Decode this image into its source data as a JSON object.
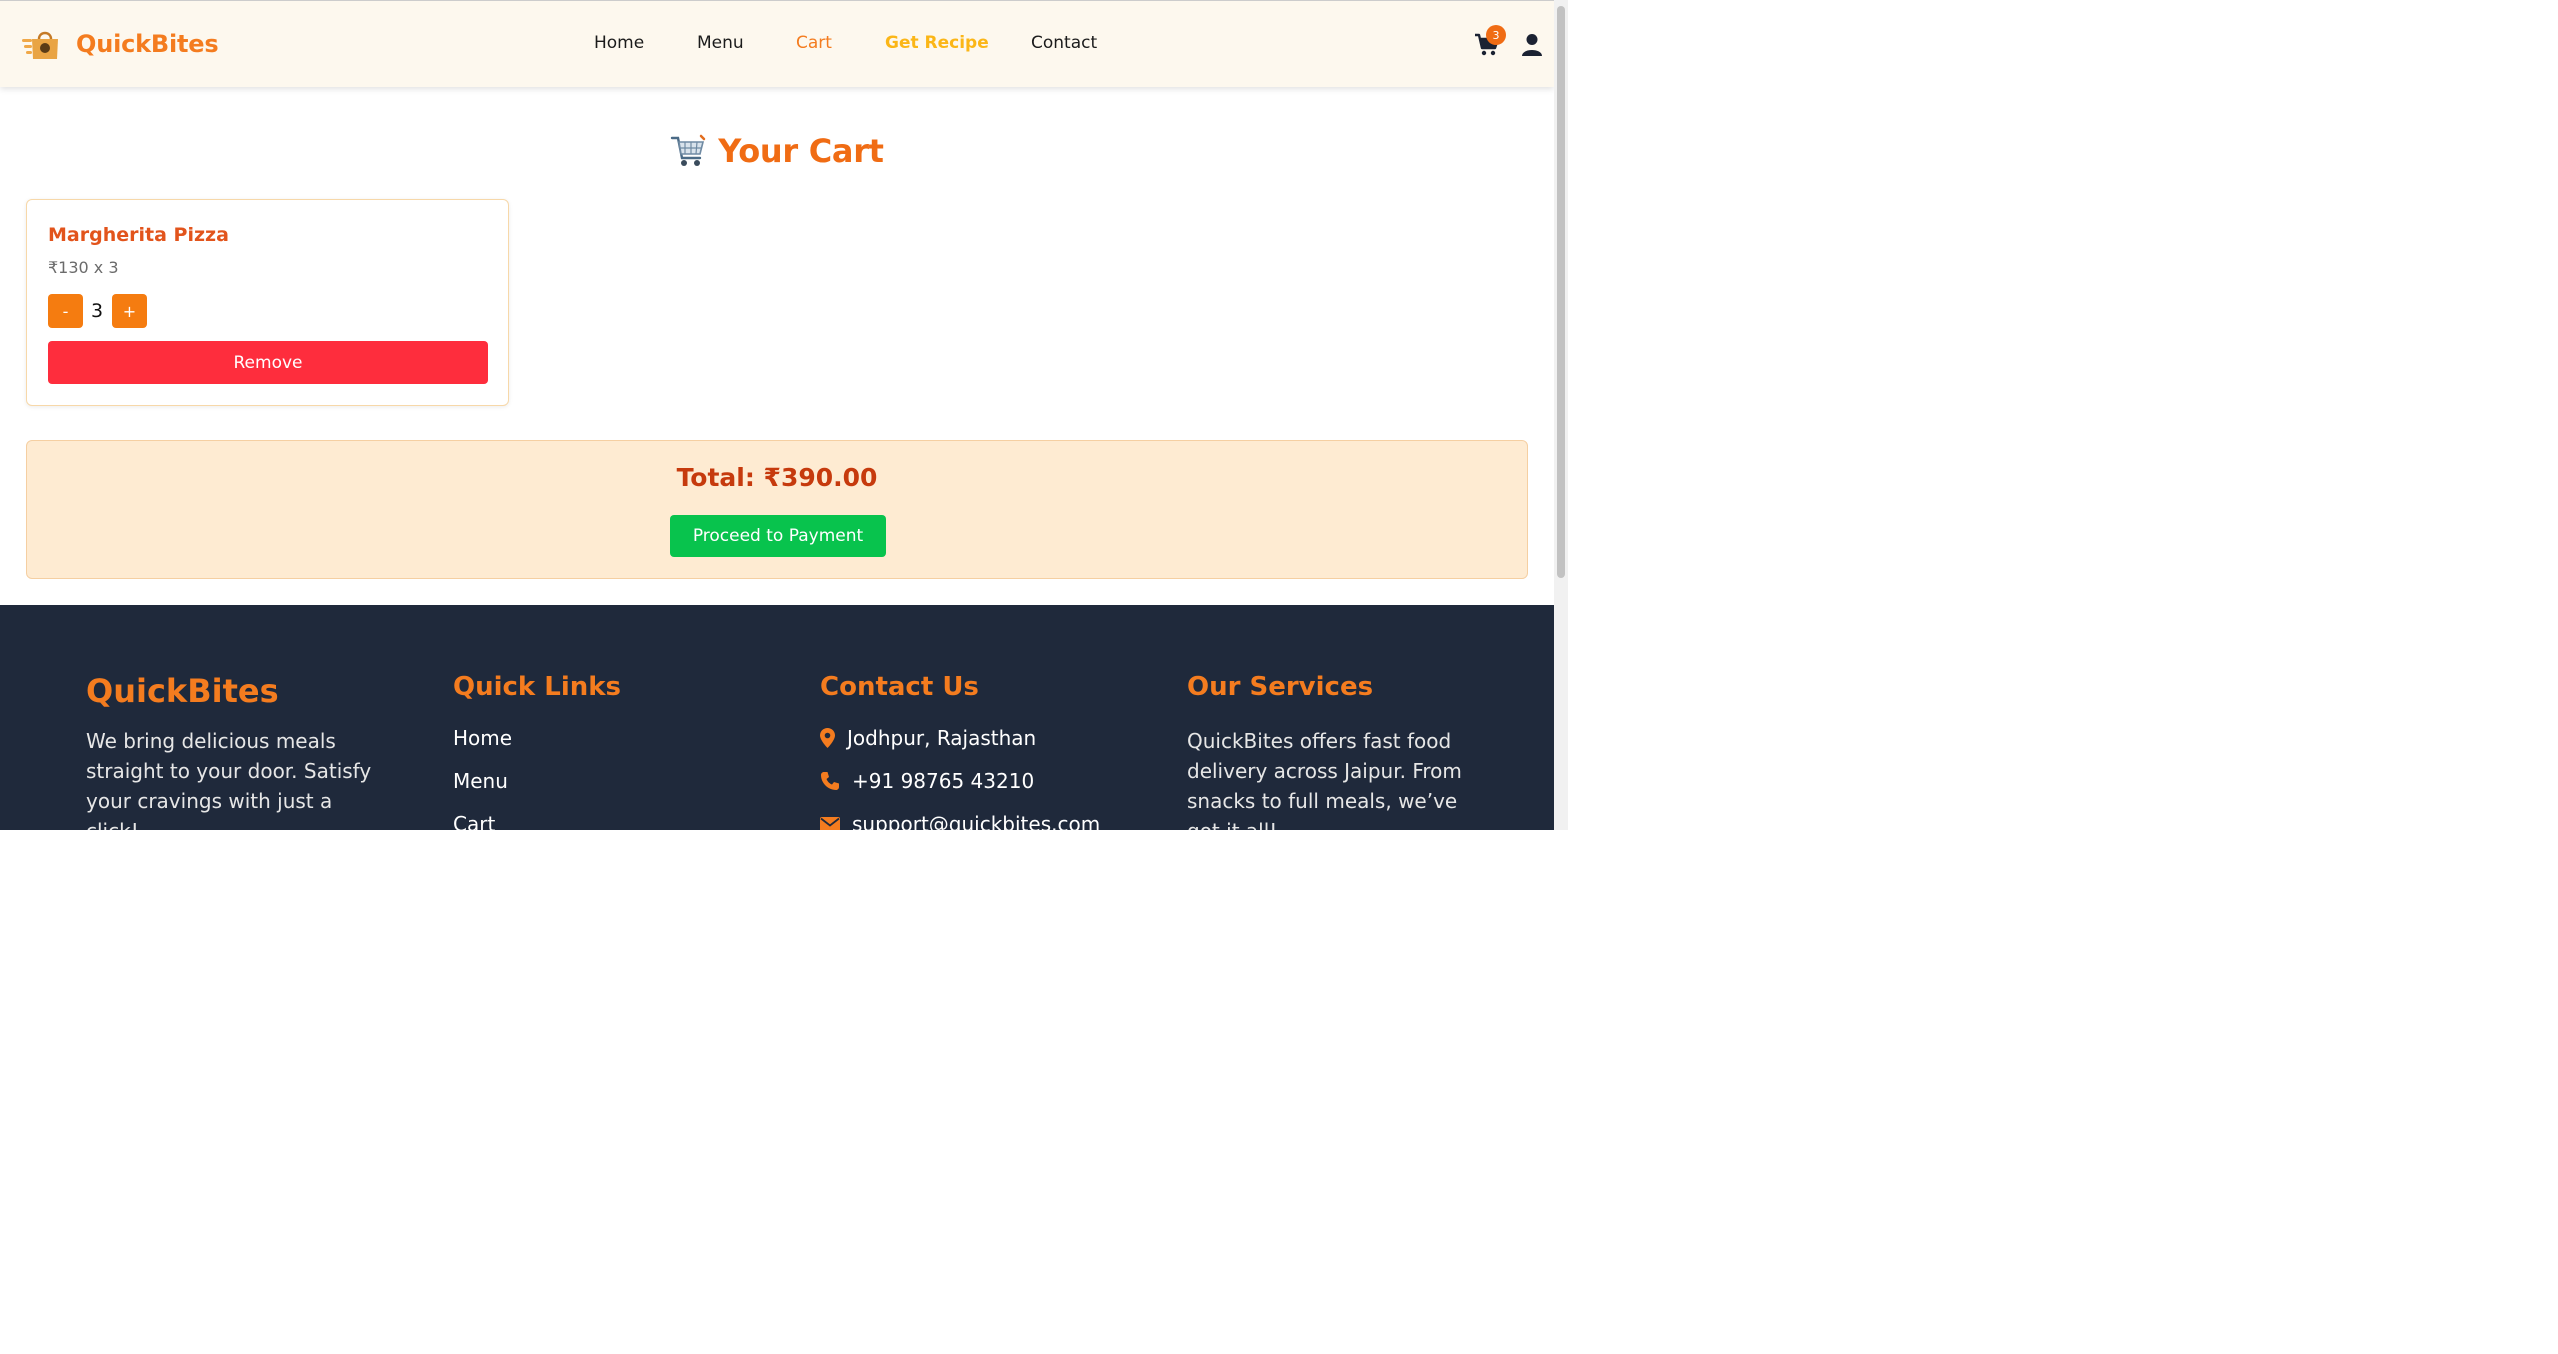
{
  "header": {
    "brand": "QuickBites",
    "nav": [
      {
        "label": "Home"
      },
      {
        "label": "Menu"
      },
      {
        "label": "Cart"
      },
      {
        "label": "Get Recipe"
      },
      {
        "label": "Contact"
      }
    ],
    "cart_count": "3",
    "colors": {
      "accent": "#f47c1f",
      "recipe": "#fbb617",
      "background": "#fdf8ee"
    },
    "icons": [
      "delivery-bag-icon",
      "cart-icon",
      "user-icon"
    ]
  },
  "main": {
    "title": "Your Cart",
    "title_icon": "shopping-cart-icon",
    "items": [
      {
        "name": "Margherita Pizza",
        "price_line": "₹130 x 3",
        "quantity": "3",
        "minus_label": "-",
        "plus_label": "+",
        "remove_label": "Remove"
      }
    ],
    "total": "Total: ₹390.00",
    "pay_label": "Proceed to Payment",
    "colors": {
      "remove": "#fe2d3d",
      "pay": "#08c34d",
      "total": "#c63a0d"
    }
  },
  "footer": {
    "brand": "QuickBites",
    "about_lines": [
      "We bring delicious meals",
      "straight to your door. Satisfy",
      "your cravings with just a",
      "click!"
    ],
    "links_heading": "Quick Links",
    "links": [
      "Home",
      "Menu",
      "Cart"
    ],
    "contact_heading": "Contact Us",
    "contact": [
      {
        "icon": "location-pin-icon",
        "text": "Jodhpur, Rajasthan"
      },
      {
        "icon": "phone-icon",
        "text": "+91 98765 43210"
      },
      {
        "icon": "envelope-icon",
        "text": "support@quickbites.com"
      }
    ],
    "services_heading": "Our Services",
    "services_lines": [
      "QuickBites offers fast food",
      "delivery across Jaipur. From",
      "snacks to full meals, we’ve",
      "got it all!"
    ],
    "colors": {
      "background": "#1f293b"
    }
  }
}
